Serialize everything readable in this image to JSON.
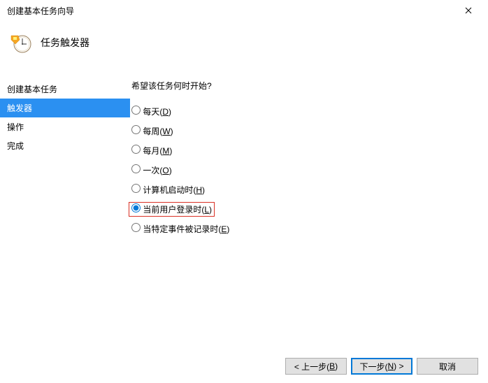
{
  "window": {
    "title": "创建基本任务向导"
  },
  "header": {
    "title": "任务触发器"
  },
  "sidebar": {
    "items": [
      {
        "label": "创建基本任务",
        "selected": false
      },
      {
        "label": "触发器",
        "selected": true
      },
      {
        "label": "操作",
        "selected": false
      },
      {
        "label": "完成",
        "selected": false
      }
    ]
  },
  "main": {
    "question": "希望该任务何时开始?",
    "options": [
      {
        "label_pre": "每天(",
        "mnemonic": "D",
        "label_post": ")",
        "checked": false,
        "highlighted": false
      },
      {
        "label_pre": "每周(",
        "mnemonic": "W",
        "label_post": ")",
        "checked": false,
        "highlighted": false
      },
      {
        "label_pre": "每月(",
        "mnemonic": "M",
        "label_post": ")",
        "checked": false,
        "highlighted": false
      },
      {
        "label_pre": "一次(",
        "mnemonic": "O",
        "label_post": ")",
        "checked": false,
        "highlighted": false
      },
      {
        "label_pre": "计算机启动时(",
        "mnemonic": "H",
        "label_post": ")",
        "checked": false,
        "highlighted": false
      },
      {
        "label_pre": "当前用户登录时(",
        "mnemonic": "L",
        "label_post": ")",
        "checked": true,
        "highlighted": true
      },
      {
        "label_pre": "当特定事件被记录时(",
        "mnemonic": "E",
        "label_post": ")",
        "checked": false,
        "highlighted": false
      }
    ]
  },
  "footer": {
    "back": {
      "pre": "< 上一步(",
      "mnemonic": "B",
      "post": ")"
    },
    "next": {
      "pre": "下一步(",
      "mnemonic": "N",
      "post": ") >"
    },
    "cancel": "取消"
  }
}
